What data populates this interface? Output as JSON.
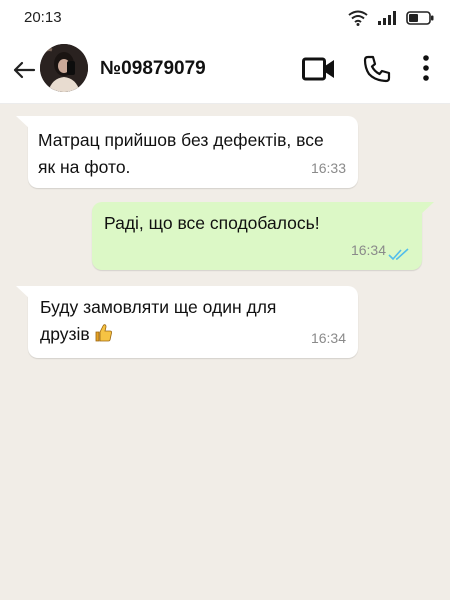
{
  "status_bar": {
    "time": "20:13"
  },
  "header": {
    "contact_name": "№09879079"
  },
  "messages": [
    {
      "direction": "in",
      "text": "Матрац прийшов без дефектів, все як на фото.",
      "time": "16:33"
    },
    {
      "direction": "out",
      "text": "Раді, що все сподобалось!",
      "time": "16:34",
      "status": "read"
    },
    {
      "direction": "in",
      "text": "Буду замовляти ще один для друзів",
      "emoji": "thumbs-up",
      "time": "16:34"
    }
  ],
  "colors": {
    "chat_background": "#f1ede7",
    "incoming_bubble": "#ffffff",
    "outgoing_bubble": "#dcf8c6",
    "read_ticks": "#53bdeb"
  }
}
